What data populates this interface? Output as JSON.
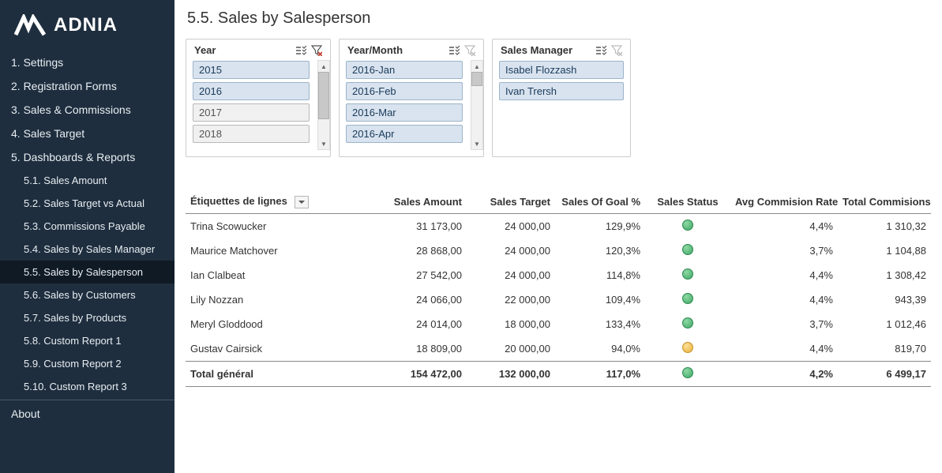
{
  "brand": "ADNIA",
  "page_title": "5.5. Sales by Salesperson",
  "sidebar": {
    "items": [
      {
        "label": "1. Settings"
      },
      {
        "label": "2. Registration Forms"
      },
      {
        "label": "3. Sales & Commissions"
      },
      {
        "label": "4. Sales Target"
      },
      {
        "label": "5. Dashboards & Reports"
      }
    ],
    "subitems": [
      {
        "label": "5.1. Sales Amount"
      },
      {
        "label": "5.2. Sales Target vs Actual"
      },
      {
        "label": "5.3. Commissions Payable"
      },
      {
        "label": "5.4. Sales by Sales Manager"
      },
      {
        "label": "5.5. Sales by Salesperson",
        "active": true
      },
      {
        "label": "5.6. Sales by Customers"
      },
      {
        "label": "5.7. Sales by Products"
      },
      {
        "label": "5.8. Custom Report 1"
      },
      {
        "label": "5.9. Custom Report 2"
      },
      {
        "label": "5.10. Custom Report 3"
      }
    ],
    "about": "About"
  },
  "slicers": {
    "year": {
      "title": "Year",
      "options": [
        {
          "label": "2015",
          "selected": true
        },
        {
          "label": "2016",
          "selected": true
        },
        {
          "label": "2017",
          "selected": false
        },
        {
          "label": "2018",
          "selected": false
        }
      ]
    },
    "year_month": {
      "title": "Year/Month",
      "options": [
        {
          "label": "2016-Jan",
          "selected": true
        },
        {
          "label": "2016-Feb",
          "selected": true
        },
        {
          "label": "2016-Mar",
          "selected": true
        },
        {
          "label": "2016-Apr",
          "selected": true
        }
      ]
    },
    "manager": {
      "title": "Sales Manager",
      "options": [
        {
          "label": "Isabel Flozzash",
          "selected": true
        },
        {
          "label": "Ivan Trersh",
          "selected": true
        }
      ]
    }
  },
  "table": {
    "columns": [
      "Étiquettes de lignes",
      "Sales Amount",
      "Sales Target",
      "Sales Of Goal %",
      "Sales Status",
      "Avg Commision Rate",
      "Total Commisions"
    ],
    "rows": [
      {
        "name": "Trina Scowucker",
        "amount": "31 173,00",
        "target": "24 000,00",
        "goal": "129,9%",
        "status": "green",
        "rate": "4,4%",
        "comm": "1 310,32"
      },
      {
        "name": "Maurice Matchover",
        "amount": "28 868,00",
        "target": "24 000,00",
        "goal": "120,3%",
        "status": "green",
        "rate": "3,7%",
        "comm": "1 104,88"
      },
      {
        "name": "Ian Clalbeat",
        "amount": "27 542,00",
        "target": "24 000,00",
        "goal": "114,8%",
        "status": "green",
        "rate": "4,4%",
        "comm": "1 308,42"
      },
      {
        "name": "Lily Nozzan",
        "amount": "24 066,00",
        "target": "22 000,00",
        "goal": "109,4%",
        "status": "green",
        "rate": "4,4%",
        "comm": "943,39"
      },
      {
        "name": "Meryl Gloddood",
        "amount": "24 014,00",
        "target": "18 000,00",
        "goal": "133,4%",
        "status": "green",
        "rate": "3,7%",
        "comm": "1 012,46"
      },
      {
        "name": "Gustav Cairsick",
        "amount": "18 809,00",
        "target": "20 000,00",
        "goal": "94,0%",
        "status": "amber",
        "rate": "4,4%",
        "comm": "819,70"
      }
    ],
    "total": {
      "name": "Total général",
      "amount": "154 472,00",
      "target": "132 000,00",
      "goal": "117,0%",
      "status": "green",
      "rate": "4,2%",
      "comm": "6 499,17"
    }
  }
}
